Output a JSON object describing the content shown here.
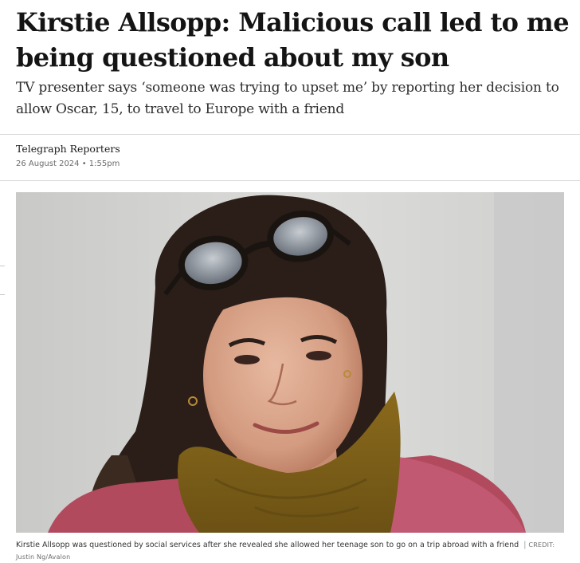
{
  "article": {
    "headline": "Kirstie Allsopp: Malicious call led to me being questioned about my son",
    "standfirst": "TV presenter says ‘someone was trying to upset me’ by reporting her decision to allow Oscar, 15, to travel to Europe with a friend",
    "byline": "Telegraph Reporters",
    "dateline": "26 August 2024 • 1:55pm"
  },
  "image": {
    "caption": "Kirstie Allsopp was questioned by social services after she revealed she allowed her teenage son to go on a trip abroad with a friend",
    "separator": "|",
    "credit_label": "CREDIT:",
    "credit_value": "Justin Ng/Avalon"
  }
}
